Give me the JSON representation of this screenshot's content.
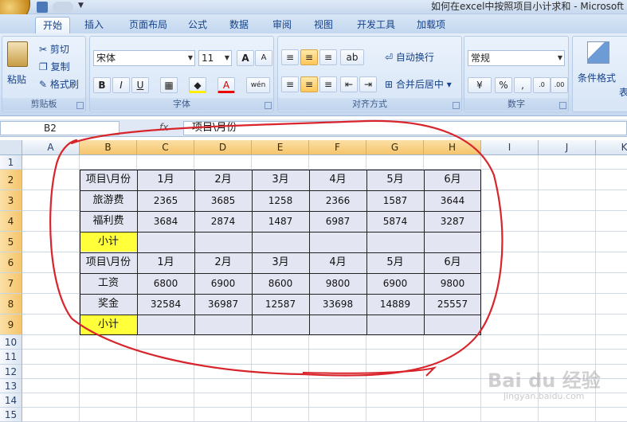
{
  "window": {
    "title": "如何在excel中按照项目小计求和 - Microsoft"
  },
  "tabs": [
    {
      "label": "开始",
      "active": true
    },
    {
      "label": "插入"
    },
    {
      "label": "页面布局"
    },
    {
      "label": "公式"
    },
    {
      "label": "数据"
    },
    {
      "label": "审阅"
    },
    {
      "label": "视图"
    },
    {
      "label": "开发工具"
    },
    {
      "label": "加载项"
    }
  ],
  "ribbon": {
    "clipboard": {
      "paste": "粘贴",
      "cut": "剪切",
      "copy": "复制",
      "format_painter": "格式刷",
      "label": "剪贴板"
    },
    "font": {
      "name": "宋体",
      "size": "11",
      "grow": "A",
      "shrink": "A",
      "bold": "B",
      "italic": "I",
      "underline": "U",
      "color_letter": "A",
      "phonetic": "wén",
      "label": "字体"
    },
    "alignment": {
      "wrap": "自动换行",
      "merge": "合并后居中",
      "label": "对齐方式"
    },
    "number": {
      "format": "常规",
      "percent": "%",
      "comma": ",",
      "label": "数字"
    },
    "styles": {
      "conditional": "条件格式",
      "extra": "表"
    }
  },
  "formula_bar": {
    "name_box": "B2",
    "fx": "fx",
    "formula": "项目\\月份"
  },
  "grid": {
    "columns": [
      "A",
      "B",
      "C",
      "D",
      "E",
      "F",
      "G",
      "H",
      "I",
      "J",
      "K"
    ],
    "selected_columns": [
      "B",
      "C",
      "D",
      "E",
      "F",
      "G",
      "H"
    ],
    "rows": [
      "1",
      "2",
      "3",
      "4",
      "5",
      "6",
      "7",
      "8",
      "9",
      "10",
      "11",
      "12",
      "13",
      "14",
      "15"
    ],
    "selected_rows": [
      "2",
      "3",
      "4",
      "5",
      "6",
      "7",
      "8",
      "9"
    ]
  },
  "table": [
    [
      "项目\\月份",
      "1月",
      "2月",
      "3月",
      "4月",
      "5月",
      "6月"
    ],
    [
      "旅游费",
      "2365",
      "3685",
      "1258",
      "2366",
      "1587",
      "3644"
    ],
    [
      "福利费",
      "3684",
      "2874",
      "1487",
      "6987",
      "5874",
      "3287"
    ],
    [
      "小计",
      "",
      "",
      "",
      "",
      "",
      ""
    ],
    [
      "项目\\月份",
      "1月",
      "2月",
      "3月",
      "4月",
      "5月",
      "6月"
    ],
    [
      "工资",
      "6800",
      "6900",
      "8600",
      "9800",
      "6900",
      "9800"
    ],
    [
      "奖金",
      "32584",
      "36987",
      "12587",
      "33698",
      "14889",
      "25557"
    ],
    [
      "小计",
      "",
      "",
      "",
      "",
      "",
      ""
    ]
  ],
  "colors": {
    "subtotal_highlight": "#ffff3a",
    "table_fill": "#e3e6f2",
    "annotation": "#d8242b"
  },
  "watermark": {
    "logo": "Bai du 经验",
    "url": "jingyan.baidu.com"
  }
}
